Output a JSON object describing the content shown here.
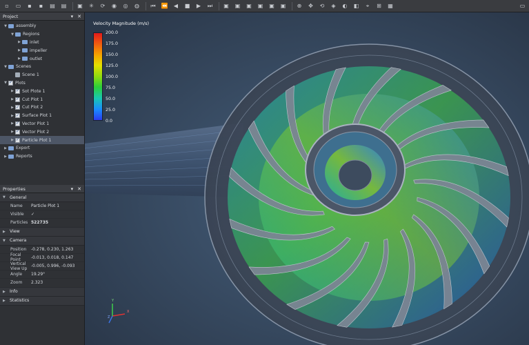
{
  "toolbar": {
    "icons": [
      "new-file-icon",
      "open-folder-icon",
      "save-icon",
      "save-as-icon",
      "import-icon",
      "export-icon",
      "screenshot-icon",
      "settings-icon",
      "refresh-icon",
      "record-icon",
      "play-circle-icon",
      "stop-circle-icon",
      "first-frame-icon",
      "step-back-icon",
      "prev-frame-icon",
      "stop-icon",
      "play-icon",
      "next-frame-icon",
      "view-fit-icon",
      "view-front-icon",
      "view-top-icon",
      "view-side-icon",
      "view-iso-icon",
      "view-reset-icon",
      "zoom-icon",
      "pan-icon",
      "rotate-icon",
      "probe-icon",
      "camera-icon",
      "clip-icon",
      "axes-icon",
      "grid-icon",
      "layout-icon"
    ],
    "glyphs": [
      "▫",
      "▭",
      "▪",
      "▪",
      "▤",
      "▤",
      "▣",
      "✳",
      "⟳",
      "◉",
      "◎",
      "◍",
      "⏮",
      "⏪",
      "◀",
      "■",
      "▶",
      "⏭",
      "▣",
      "▣",
      "▣",
      "▣",
      "▣",
      "▣",
      "⊕",
      "✥",
      "⟲",
      "◈",
      "◐",
      "◧",
      "⌖",
      "⊞",
      "▦"
    ],
    "window_glyph": "▭"
  },
  "project_panel": {
    "title": "Project",
    "tree": [
      {
        "label": "assembly",
        "depth": 0,
        "kind": "folder",
        "expanded": true
      },
      {
        "label": "Regions",
        "depth": 1,
        "kind": "folder",
        "expanded": true
      },
      {
        "label": "inlet",
        "depth": 2,
        "kind": "folder",
        "expanded": false
      },
      {
        "label": "impeller",
        "depth": 2,
        "kind": "folder",
        "expanded": false
      },
      {
        "label": "outlet",
        "depth": 2,
        "kind": "folder",
        "expanded": false
      },
      {
        "label": "Scenes",
        "depth": 0,
        "kind": "folder",
        "expanded": true
      },
      {
        "label": "Scene 1",
        "depth": 1,
        "kind": "leaf"
      },
      {
        "label": "Plots",
        "depth": 0,
        "kind": "check",
        "expanded": true
      },
      {
        "label": "Sot Plote 1",
        "depth": 1,
        "kind": "check"
      },
      {
        "label": "Cut Plot 1",
        "depth": 1,
        "kind": "check",
        "expanded": false
      },
      {
        "label": "Cut Plot 2",
        "depth": 1,
        "kind": "check",
        "expanded": false
      },
      {
        "label": "Surface Plot 1",
        "depth": 1,
        "kind": "check",
        "expanded": false
      },
      {
        "label": "Vector Plot 1",
        "depth": 1,
        "kind": "check",
        "expanded": false
      },
      {
        "label": "Vector Plot 2",
        "depth": 1,
        "kind": "check",
        "expanded": false
      },
      {
        "label": "Particle Plot 1",
        "depth": 1,
        "kind": "check",
        "expanded": false,
        "selected": true
      },
      {
        "label": "Export",
        "depth": 0,
        "kind": "folder",
        "expanded": false
      },
      {
        "label": "Reports",
        "depth": 0,
        "kind": "folder",
        "expanded": false
      }
    ]
  },
  "properties_panel": {
    "title": "Properties",
    "sections": [
      {
        "name": "General",
        "expanded": true,
        "rows": [
          {
            "key": "Name",
            "value": "Particle Plot 1"
          },
          {
            "key": "Visible",
            "value": "✓"
          },
          {
            "key": "Particles",
            "value": "522735",
            "bold": true
          }
        ]
      },
      {
        "name": "View",
        "expanded": false,
        "rows": []
      },
      {
        "name": "Camera",
        "expanded": true,
        "rows": [
          {
            "key": "Position",
            "value": "-0.278, 0.230, 1.263"
          },
          {
            "key": "Focal Point",
            "value": "-0.013, 0.018, 0.147"
          },
          {
            "key": "Vertical View Up",
            "value": "-0.005, 0.996, -0.093"
          },
          {
            "key": "Angle",
            "value": "19.29°"
          },
          {
            "key": "Zoom",
            "value": "2.323"
          }
        ]
      },
      {
        "name": "Info",
        "expanded": false,
        "rows": []
      },
      {
        "name": "Statistics",
        "expanded": false,
        "rows": []
      }
    ]
  },
  "viewport": {
    "legend": {
      "title": "Velocity Magnitude (m/s)",
      "labels": [
        "200.0",
        "175.0",
        "150.0",
        "125.0",
        "100.0",
        "75.0",
        "50.0",
        "25.0",
        "0.0"
      ]
    },
    "axes": {
      "x": "X",
      "y": "Y",
      "z": "Z"
    }
  },
  "colors": {
    "accent": "#4d5666",
    "background": "#34445a",
    "panel": "#2f3135"
  }
}
